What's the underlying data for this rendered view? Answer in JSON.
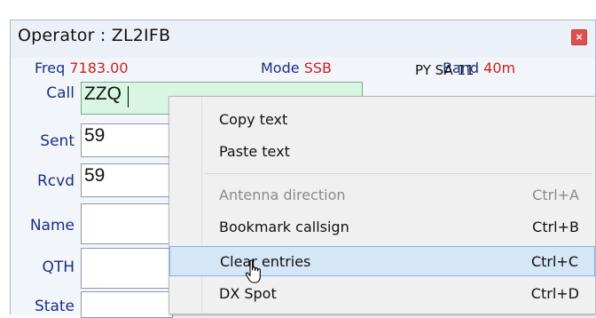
{
  "window": {
    "title": "Operator : ZL2IFB",
    "close_glyph": "×"
  },
  "header": {
    "freq_label": "Freq",
    "freq_value": "7183.00",
    "mode_label": "Mode",
    "mode_value": "SSB",
    "band_label": "Band",
    "band_value": "40m"
  },
  "fields": {
    "call": {
      "label": "Call",
      "value": "ZZQ"
    },
    "sent": {
      "label": "Sent",
      "value": "59"
    },
    "rcvd": {
      "label": "Rcvd",
      "value": "59"
    },
    "name": {
      "label": "Name",
      "value": ""
    },
    "qth": {
      "label": "QTH",
      "value": ""
    },
    "state": {
      "label": "State",
      "value": ""
    }
  },
  "right_info": "PY SA 11",
  "context_menu": {
    "items": [
      {
        "label": "Copy text",
        "shortcut": ""
      },
      {
        "label": "Paste text",
        "shortcut": ""
      },
      {
        "label": "Antenna direction",
        "shortcut": "Ctrl+A"
      },
      {
        "label": "Bookmark callsign",
        "shortcut": "Ctrl+B"
      },
      {
        "label": "Clear entries",
        "shortcut": "Ctrl+C"
      },
      {
        "label": "DX Spot",
        "shortcut": "Ctrl+D"
      }
    ]
  },
  "colors": {
    "accent_label": "#1a2e86",
    "value_red": "#cc1f1f",
    "call_bg": "#d9f5e3",
    "highlight": "#d5e6f7"
  }
}
